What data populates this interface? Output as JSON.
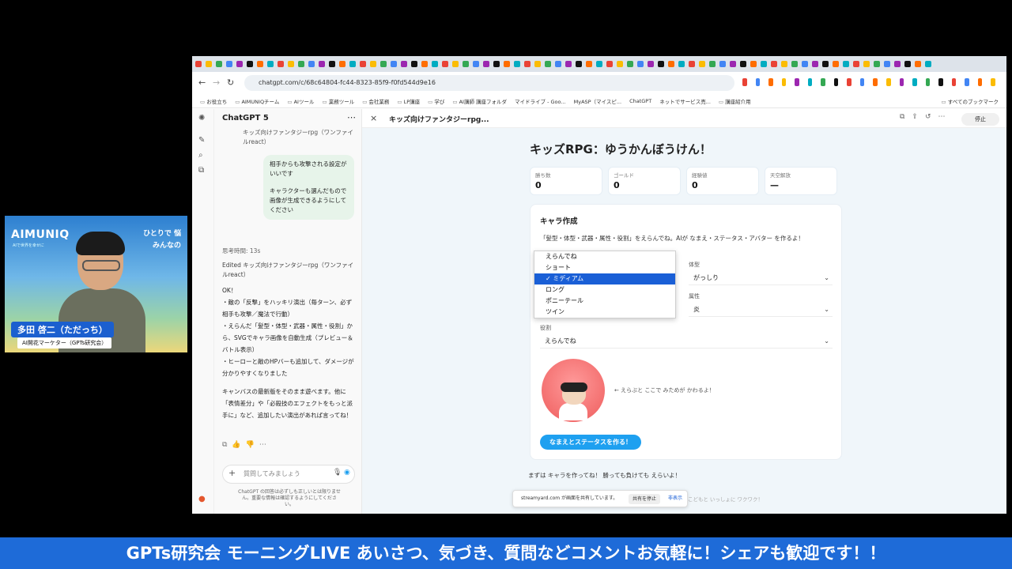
{
  "webcam": {
    "logo": "AIMUNIQ",
    "logo_sub": "AIで世界を幸せに",
    "tagline_1": "ひとりで 悩",
    "tagline_2": "みんなの",
    "name": "多田 啓二（ただっち）",
    "role": "AI開花マーケター（GPTs研究会）"
  },
  "browser": {
    "url": "chatgpt.com/c/68c64804-fc44-8323-85f9-f0fd544d9e16",
    "bookmarks": [
      "お役立ち",
      "AIMUNIQチーム",
      "AIツール",
      "業務ツール",
      "会社業務",
      "LP講座",
      "学び",
      "AI講師 講座フォルダ",
      "マイドライブ - Goo...",
      "MyASP（マイスピ...",
      "ChatGPT",
      "ネットでサービス売...",
      "講座紹介用",
      "すべてのブックマーク"
    ]
  },
  "chat": {
    "model": "ChatGPT 5",
    "ref_note": "キッズ向けファンタジーrpg（ワンファイルreact）",
    "user_msg_1": "相手からも攻撃される設定がいいです",
    "user_msg_2": "キャラクターも選んだもので画像が生成できるようにしてください",
    "thinking": "思考時間: 13s",
    "edited": "Edited キッズ向けファンタジーrpg（ワンファイルreact）",
    "reply_1": "OK！",
    "reply_2": "・敵の「反撃」をハッキリ演出（毎ターン、必ず相手も攻撃／魔法で行動）",
    "reply_3": "・えらんだ「髪型・体型・武器・属性・役割」から、SVGでキャラ画像を自動生成（プレビュー＆バトル表示）",
    "reply_4": "・ヒーローと敵のHPバーも追加して、ダメージが分かりやすくなりました",
    "reply_5": "キャンバスの最新版をそのまま遊べます。他に「表情差分」や「必殺技のエフェクトをもっと派手に」など、追加したい演出があれば言ってね！",
    "input_placeholder": "質問してみましょう",
    "disclaimer": "ChatGPT の回答は必ずしも正しいとは限りません。重要な情報は確認するようにしてください。"
  },
  "canvas": {
    "title": "キッズ向けファンタジーrpg...",
    "stop_label": "停止",
    "game_title": "キッズRPG：ゆうかんぼうけん！",
    "stats": [
      {
        "label": "勝ち数",
        "value": "0"
      },
      {
        "label": "ゴールド",
        "value": "0"
      },
      {
        "label": "経験値",
        "value": "0"
      },
      {
        "label": "天空解放",
        "value": "—"
      }
    ],
    "creator": {
      "heading": "キャラ作成",
      "desc": "「髪型・体型・武器・属性・役割」をえらんでね。AIが なまえ・ステータス・アバター を作るよ！",
      "body_label": "体型",
      "body_value": "がっしり",
      "element_label": "属性",
      "element_value": "炎",
      "role_label": "役割",
      "role_value": "えらんでね",
      "hair_options": [
        "えらんでね",
        "ショート",
        "ミディアム",
        "ロング",
        "ポニーテール",
        "ツイン"
      ],
      "hair_selected": "ミディアム",
      "avatar_hint": "← えらぶと ここで みためが かわるよ！",
      "make_button": "なまえとステータスを作る！"
    },
    "footer_msg": "まずは キャラを作ってね！ 勝っても負けても えらいよ！",
    "share_text": "streamyard.com が画面を共有しています。",
    "share_stop": "共有を停止",
    "share_hide": "非表示",
    "faint_text": "こどもと いっしょに ワクワク！"
  },
  "banner": "GPTs研究会 モーニングLIVE あいさつ、気づき、質問などコメントお気軽に！シェアも歓迎です！！"
}
